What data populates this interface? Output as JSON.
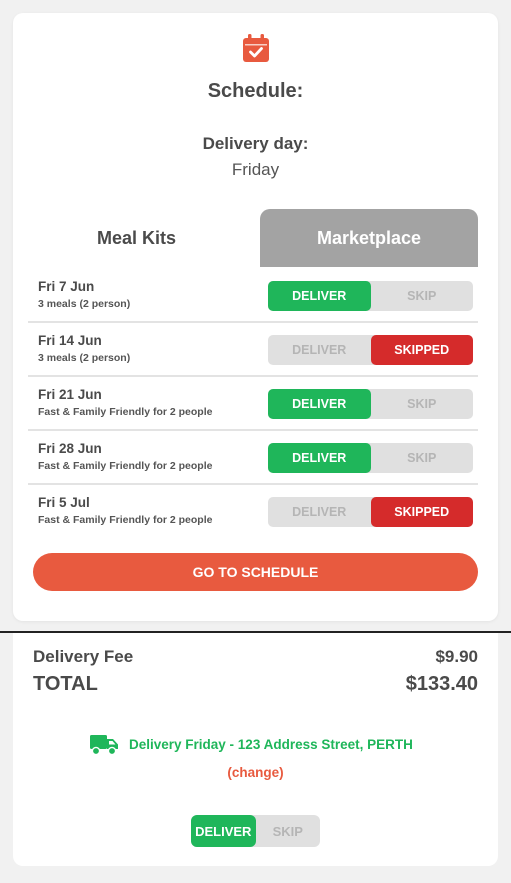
{
  "schedule": {
    "title": "Schedule:",
    "delivery_day_label": "Delivery day:",
    "delivery_day_value": "Friday",
    "icon": "calendar-check-icon"
  },
  "tabs": [
    {
      "label": "Meal Kits",
      "active": false
    },
    {
      "label": "Marketplace",
      "active": true
    }
  ],
  "rows": [
    {
      "date": "Fri 7 Jun",
      "desc": "3 meals (2 person)",
      "deliver_label": "DELIVER",
      "skip_label": "SKIP",
      "state": "deliver"
    },
    {
      "date": "Fri 14 Jun",
      "desc": "3 meals (2 person)",
      "deliver_label": "DELIVER",
      "skip_label": "SKIPPED",
      "state": "skipped"
    },
    {
      "date": "Fri 21 Jun",
      "desc": "Fast & Family Friendly for 2 people",
      "deliver_label": "DELIVER",
      "skip_label": "SKIP",
      "state": "deliver"
    },
    {
      "date": "Fri 28 Jun",
      "desc": "Fast & Family Friendly for 2 people",
      "deliver_label": "DELIVER",
      "skip_label": "SKIP",
      "state": "deliver"
    },
    {
      "date": "Fri 5 Jul",
      "desc": "Fast & Family Friendly for 2 people",
      "deliver_label": "DELIVER",
      "skip_label": "SKIPPED",
      "state": "skipped"
    }
  ],
  "goto_label": "GO TO SCHEDULE",
  "summary": {
    "fee_label": "Delivery Fee",
    "fee_value": "$9.90",
    "total_label": "TOTAL",
    "total_value": "$133.40",
    "delivery_info": "Delivery Friday - 123 Address Street, PERTH",
    "change_label": "(change)",
    "truck_icon": "truck-icon",
    "deliver_label": "DELIVER",
    "skip_label": "SKIP",
    "state": "deliver"
  },
  "colors": {
    "accent": "#e85a3f",
    "green": "#1fb65a",
    "red": "#d52b2b",
    "tab_active": "#a3a3a3",
    "toggle_off": "#e0e0e0"
  }
}
